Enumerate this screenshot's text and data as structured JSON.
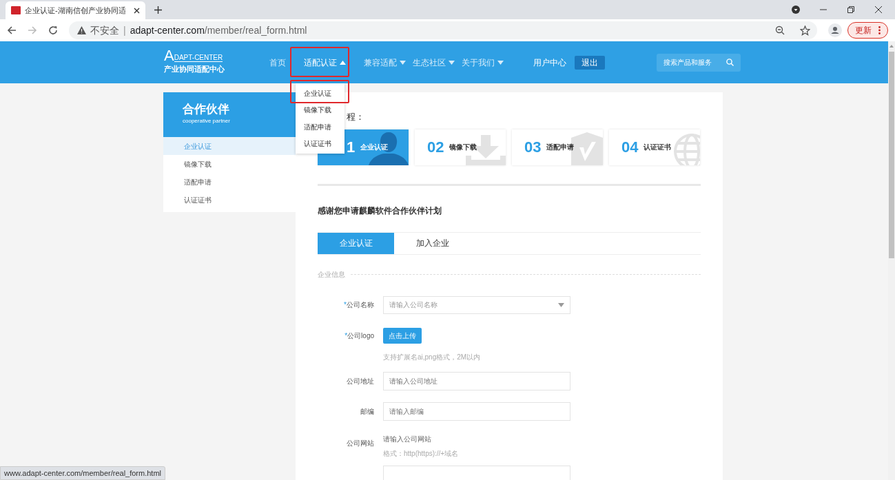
{
  "browser": {
    "tab_title": "企业认证-湖南信创产业协同适",
    "security": "不安全",
    "separator": "|",
    "url_host": "adapt-center.com",
    "url_path": "/member/real_form.html",
    "update_button": "更新"
  },
  "header": {
    "logo_letter": "A",
    "logo_text": "DAPT-CENTER",
    "logo_subtitle": "产业协同适配中心",
    "nav": [
      {
        "label": "首页",
        "selected": false,
        "has_menu": false
      },
      {
        "label": "适配认证",
        "selected": true,
        "has_menu": true,
        "expanded": true
      },
      {
        "label": "兼容适配",
        "selected": false,
        "has_menu": true,
        "expanded": false
      },
      {
        "label": "生态社区",
        "selected": false,
        "has_menu": true,
        "expanded": false
      },
      {
        "label": "关于我们",
        "selected": false,
        "has_menu": true,
        "expanded": false
      }
    ],
    "user_center": "用户中心",
    "logout": "退出",
    "search": {
      "placeholder": "搜索产品和服务"
    }
  },
  "dropdown": {
    "items": [
      {
        "label": "企业认证"
      },
      {
        "label": "镜像下载"
      },
      {
        "label": "适配申请"
      },
      {
        "label": "认证证书"
      }
    ]
  },
  "sidebar": {
    "title": "合作伙伴",
    "subtitle": "cooperative partner",
    "items": [
      {
        "label": "企业认证",
        "selected": true
      },
      {
        "label": "镜像下载",
        "selected": false
      },
      {
        "label": "适配申请",
        "selected": false
      },
      {
        "label": "认证证书",
        "selected": false
      }
    ]
  },
  "main": {
    "process_heading": "程：",
    "steps": [
      {
        "number": "1",
        "label": "企业认证",
        "selected": true,
        "kind": "person"
      },
      {
        "number": "02",
        "label": "镜像下载",
        "selected": false,
        "kind": "download"
      },
      {
        "number": "03",
        "label": "适配申请",
        "selected": false,
        "kind": "shield"
      },
      {
        "number": "04",
        "label": "认证证书",
        "selected": false,
        "kind": "globe"
      }
    ],
    "intro": "感谢您申请麒麟软件合作伙伴计划",
    "tabs": [
      {
        "label": "企业认证",
        "selected": true
      },
      {
        "label": "加入企业",
        "selected": false
      }
    ],
    "section": "企业信息",
    "form": [
      {
        "kind": "select",
        "label": "公司名称",
        "mark": "*",
        "placeholder": "请输入公司名称"
      },
      {
        "kind": "upload",
        "label": "公司logo",
        "mark": "*",
        "button": "点击上传",
        "hint": "支持扩展名ai,png格式，2M以内"
      },
      {
        "kind": "input",
        "label": "公司地址",
        "placeholder": "请输入公司地址"
      },
      {
        "kind": "input",
        "label": "邮编",
        "placeholder": "请输入邮编"
      },
      {
        "kind": "text",
        "label": "公司网站",
        "placeholder": "请输入公司网站",
        "hint": "格式：http(https)://+域名"
      },
      {
        "kind": "blank"
      }
    ]
  },
  "status_url": "www.adapt-center.com/member/real_form.html"
}
